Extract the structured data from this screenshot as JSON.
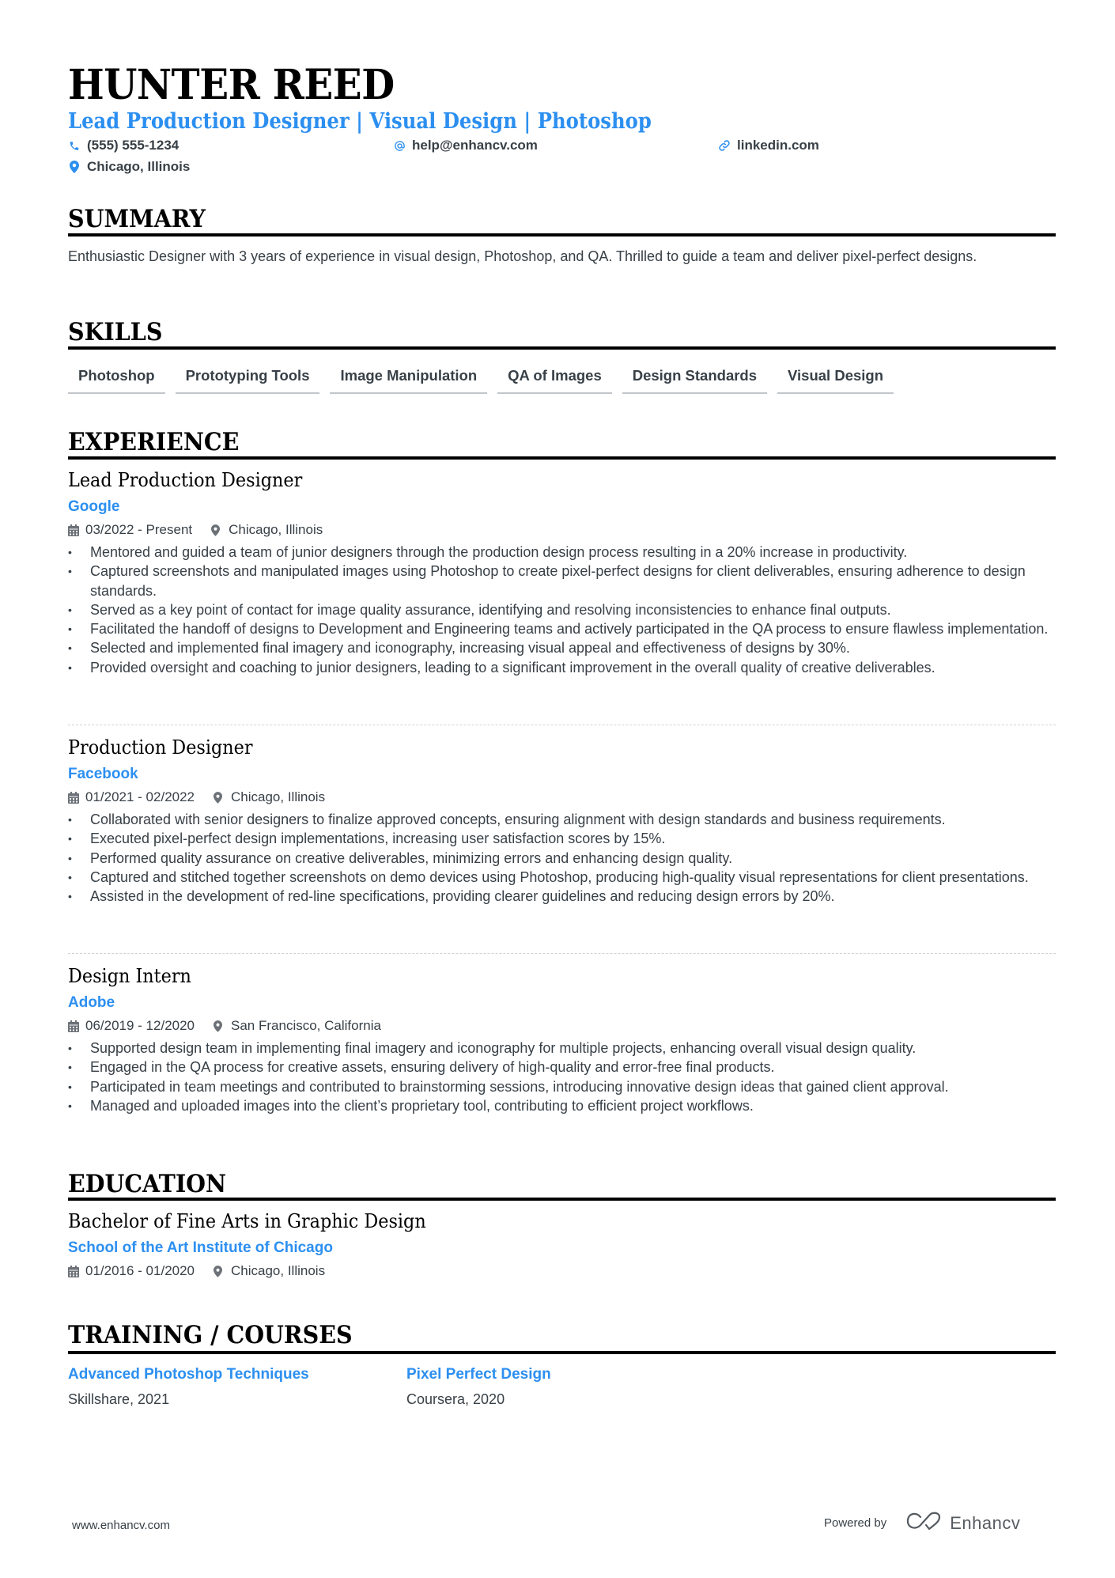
{
  "header": {
    "name": "HUNTER REED",
    "headline": "Lead Production Designer | Visual Design | Photoshop",
    "contacts": {
      "phone": {
        "icon": "phone-icon",
        "value": "(555) 555-1234"
      },
      "email": {
        "icon": "at-icon",
        "value": "help@enhancv.com"
      },
      "link": {
        "icon": "link-icon",
        "value": "linkedin.com"
      },
      "location": {
        "icon": "location-pin-icon",
        "value": "Chicago, Illinois"
      }
    }
  },
  "summary": {
    "title": "SUMMARY",
    "text": "Enthusiastic Designer with 3 years of experience in visual design, Photoshop, and QA. Thrilled to guide a team and deliver pixel-perfect designs."
  },
  "skills": {
    "title": "SKILLS",
    "items": [
      "Photoshop",
      "Prototyping Tools",
      "Image Manipulation",
      "QA of Images",
      "Design Standards",
      "Visual Design"
    ]
  },
  "experience": {
    "title": "EXPERIENCE",
    "jobs": [
      {
        "title": "Lead Production Designer",
        "company": "Google",
        "dates": "03/2022 - Present",
        "location": "Chicago, Illinois",
        "bullets": [
          "Mentored and guided a team of junior designers through the production design process resulting in a 20% increase in productivity.",
          "Captured screenshots and manipulated images using Photoshop to create pixel-perfect designs for client deliverables, ensuring adherence to design standards.",
          "Served as a key point of contact for image quality assurance, identifying and resolving inconsistencies to enhance final outputs.",
          "Facilitated the handoff of designs to Development and Engineering teams and actively participated in the QA process to ensure flawless implementation.",
          "Selected and implemented final imagery and iconography, increasing visual appeal and effectiveness of designs by 30%.",
          "Provided oversight and coaching to junior designers, leading to a significant improvement in the overall quality of creative deliverables."
        ]
      },
      {
        "title": "Production Designer",
        "company": "Facebook",
        "dates": "01/2021 - 02/2022",
        "location": "Chicago, Illinois",
        "bullets": [
          "Collaborated with senior designers to finalize approved concepts, ensuring alignment with design standards and business requirements.",
          "Executed pixel-perfect design implementations, increasing user satisfaction scores by 15%.",
          "Performed quality assurance on creative deliverables, minimizing errors and enhancing design quality.",
          "Captured and stitched together screenshots on demo devices using Photoshop, producing high-quality visual representations for client presentations.",
          "Assisted in the development of red-line specifications, providing clearer guidelines and reducing design errors by 20%."
        ]
      },
      {
        "title": "Design Intern",
        "company": "Adobe",
        "dates": "06/2019 - 12/2020",
        "location": "San Francisco, California",
        "bullets": [
          "Supported design team in implementing final imagery and iconography for multiple projects, enhancing overall visual design quality.",
          "Engaged in the QA process for creative assets, ensuring delivery of high-quality and error-free final products.",
          "Participated in team meetings and contributed to brainstorming sessions, introducing innovative design ideas that gained client approval.",
          "Managed and uploaded images into the client’s proprietary tool, contributing to efficient project workflows."
        ]
      }
    ]
  },
  "education": {
    "title": "EDUCATION",
    "degree": "Bachelor of Fine Arts in Graphic Design",
    "school": "School of the Art Institute of Chicago",
    "dates": "01/2016 - 01/2020",
    "location": "Chicago, Illinois"
  },
  "training": {
    "title": "TRAINING / COURSES",
    "courses": [
      {
        "title": "Advanced Photoshop Techniques",
        "provider": "Skillshare, 2021"
      },
      {
        "title": "Pixel Perfect Design",
        "provider": "Coursera, 2020"
      }
    ]
  },
  "footer": {
    "website": "www.enhancv.com",
    "powered_by": "Powered by",
    "brand": "Enhancv"
  },
  "colors": {
    "accent": "#2c8ff0",
    "text": "#384047",
    "heading": "#000000"
  }
}
